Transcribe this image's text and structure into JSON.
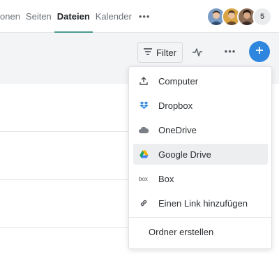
{
  "tabs": [
    {
      "label": "onen"
    },
    {
      "label": "Seiten"
    },
    {
      "label": "Dateien"
    },
    {
      "label": "Kalender"
    }
  ],
  "tabs_more": "•••",
  "members": {
    "extra_count": "5"
  },
  "toolbar": {
    "filter_label": "Filter",
    "more_label": "•••",
    "accent": "#2e86de"
  },
  "menu": {
    "items": [
      {
        "label": "Computer",
        "icon": "upload-icon"
      },
      {
        "label": "Dropbox",
        "icon": "dropbox-icon"
      },
      {
        "label": "OneDrive",
        "icon": "cloud-icon"
      },
      {
        "label": "Google Drive",
        "icon": "google-drive-icon",
        "highlighted": true
      },
      {
        "label": "Box",
        "icon": "box-icon"
      },
      {
        "label": "Einen Link hinzufügen",
        "icon": "link-icon"
      }
    ],
    "folder_label": "Ordner erstellen"
  }
}
